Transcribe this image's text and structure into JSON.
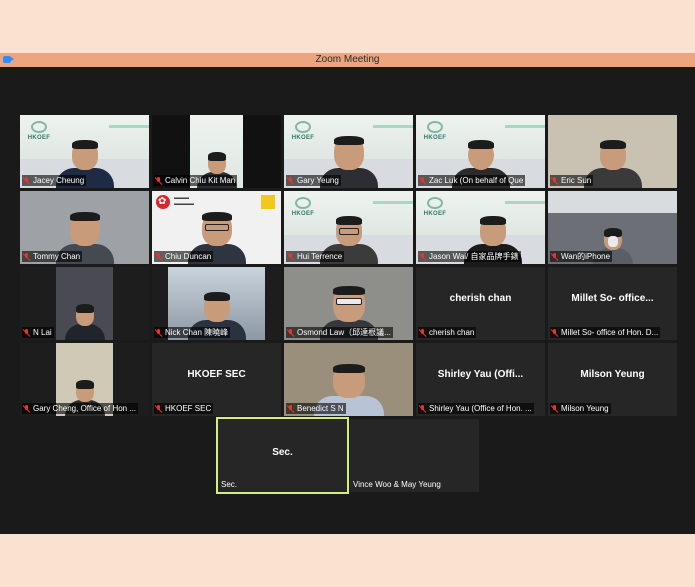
{
  "window": {
    "title": "Zoom Meeting"
  },
  "icons": {
    "app": "zoom-camera-icon",
    "mic": "mic-muted-icon"
  },
  "colors": {
    "active_speaker_border": "#d3ef7a",
    "muted_mic": "#e8352b",
    "grid_bg": "#1a1a1a"
  },
  "participants": [
    {
      "name": "Jacey Cheung"
    },
    {
      "name": "Calvin Chiu Kit Man"
    },
    {
      "name": "Gary Yeung"
    },
    {
      "name": "Zac Luk (On behalf of Que"
    },
    {
      "name": "Eric Sun"
    },
    {
      "name": "Tommy Chan"
    },
    {
      "name": "Chiu Duncan"
    },
    {
      "name": "Hui Terrence"
    },
    {
      "name": "Jason Wai/ 自家品牌手錶"
    },
    {
      "name": "Wan的iPhone"
    },
    {
      "name": "N Lai"
    },
    {
      "name": "Nick Chan 陳曉峰"
    },
    {
      "name": "Osmond Law（邱達根議..."
    },
    {
      "name": "cherish chan",
      "card": "cherish chan"
    },
    {
      "name": "Millet So- office of Hon. D...",
      "card": "Millet So- office..."
    },
    {
      "name": "Gary Cheng, Office of Hon ..."
    },
    {
      "name": "HKOEF SEC",
      "card": "HKOEF SEC"
    },
    {
      "name": "Benedict S N"
    },
    {
      "name": "Shirley Yau (Office of Hon. ...",
      "card": "Shirley Yau (Offi..."
    },
    {
      "name": "Milson Yeung",
      "card": "Milson Yeung"
    },
    {
      "name": "Sec.",
      "card": "Sec."
    },
    {
      "name": "Vince Woo & May Yeung"
    }
  ]
}
